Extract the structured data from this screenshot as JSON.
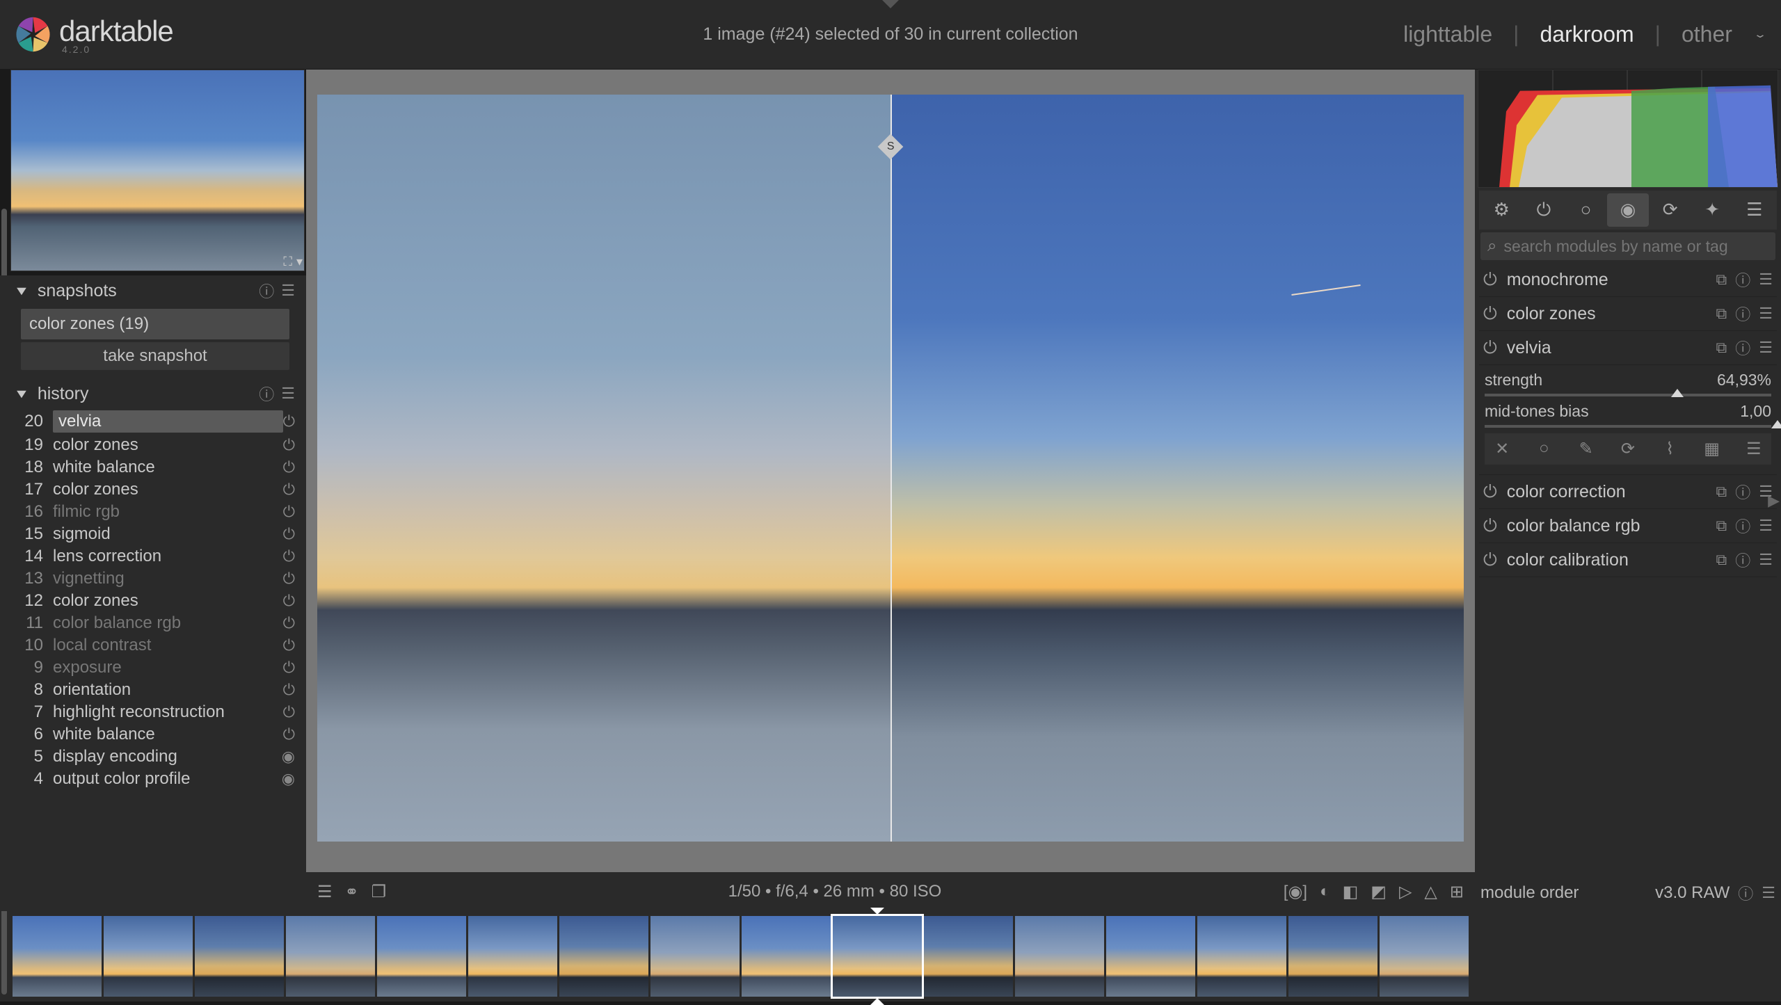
{
  "app": {
    "name": "darktable",
    "version": "4.2.0"
  },
  "topbar": {
    "status": "1 image (#24) selected of 30 in current collection",
    "views": {
      "lighttable": "lighttable",
      "darkroom": "darkroom",
      "other": "other"
    }
  },
  "snapshots": {
    "title": "snapshots",
    "items": [
      "color zones (19)"
    ],
    "take_label": "take snapshot"
  },
  "history": {
    "title": "history",
    "items": [
      {
        "n": 20,
        "label": "velvia",
        "dim": false,
        "sel": true,
        "dot": false
      },
      {
        "n": 19,
        "label": "color zones",
        "dim": false,
        "sel": false,
        "dot": false
      },
      {
        "n": 18,
        "label": "white balance",
        "dim": false,
        "sel": false,
        "dot": false
      },
      {
        "n": 17,
        "label": "color zones",
        "dim": false,
        "sel": false,
        "dot": false
      },
      {
        "n": 16,
        "label": "filmic rgb",
        "dim": true,
        "sel": false,
        "dot": false
      },
      {
        "n": 15,
        "label": "sigmoid",
        "dim": false,
        "sel": false,
        "dot": false
      },
      {
        "n": 14,
        "label": "lens correction",
        "dim": false,
        "sel": false,
        "dot": false
      },
      {
        "n": 13,
        "label": "vignetting",
        "dim": true,
        "sel": false,
        "dot": false
      },
      {
        "n": 12,
        "label": "color zones",
        "dim": false,
        "sel": false,
        "dot": false
      },
      {
        "n": 11,
        "label": "color balance rgb",
        "dim": true,
        "sel": false,
        "dot": false
      },
      {
        "n": 10,
        "label": "local contrast",
        "dim": true,
        "sel": false,
        "dot": false
      },
      {
        "n": 9,
        "label": "exposure",
        "dim": true,
        "sel": false,
        "dot": false
      },
      {
        "n": 8,
        "label": "orientation",
        "dim": false,
        "sel": false,
        "dot": false
      },
      {
        "n": 7,
        "label": "highlight reconstruction",
        "dim": false,
        "sel": false,
        "dot": false
      },
      {
        "n": 6,
        "label": "white balance",
        "dim": false,
        "sel": false,
        "dot": false
      },
      {
        "n": 5,
        "label": "display encoding",
        "dim": false,
        "sel": false,
        "dot": true
      },
      {
        "n": 4,
        "label": "output color profile",
        "dim": false,
        "sel": false,
        "dot": true
      }
    ]
  },
  "center": {
    "split_label": "S",
    "info": "1/50 • f/6,4 • 26 mm • 80 ISO"
  },
  "search": {
    "placeholder": "search modules by name or tag"
  },
  "modules": {
    "list": [
      {
        "name": "monochrome",
        "expanded": false
      },
      {
        "name": "color zones",
        "expanded": false
      },
      {
        "name": "velvia",
        "expanded": true
      },
      {
        "name": "color correction",
        "expanded": false
      },
      {
        "name": "color balance rgb",
        "expanded": false
      },
      {
        "name": "color calibration",
        "expanded": false
      }
    ],
    "velvia": {
      "strength_label": "strength",
      "strength_val": "64,93%",
      "strength_pct": 65,
      "midtones_label": "mid-tones bias",
      "midtones_val": "1,00",
      "midtones_pct": 100
    }
  },
  "module_order": {
    "label": "module order",
    "value": "v3.0 RAW"
  },
  "filmstrip": {
    "count": 16,
    "selected_index": 9
  }
}
